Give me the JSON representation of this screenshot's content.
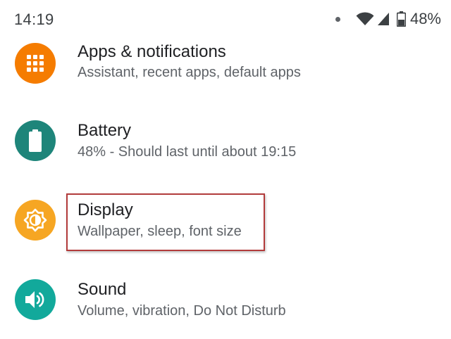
{
  "status_bar": {
    "time": "14:19",
    "battery_percent": "48%",
    "icons": [
      "notification-dot-icon",
      "wifi-icon",
      "cell-signal-icon",
      "battery-icon"
    ]
  },
  "settings": {
    "items": [
      {
        "title": "Apps & notifications",
        "subtitle": "Assistant, recent apps, default apps",
        "icon": "apps-grid-icon",
        "color": "#f57c00"
      },
      {
        "title": "Battery",
        "subtitle": "48% - Should last until about 19:15",
        "icon": "battery-icon",
        "color": "#1e857a"
      },
      {
        "title": "Display",
        "subtitle": "Wallpaper, sleep, font size",
        "icon": "brightness-icon",
        "color": "#f6a623"
      },
      {
        "title": "Sound",
        "subtitle": "Volume, vibration, Do Not Disturb",
        "icon": "volume-icon",
        "color": "#12a99b"
      }
    ]
  },
  "annotation": {
    "highlight_color": "#b23b3b"
  }
}
